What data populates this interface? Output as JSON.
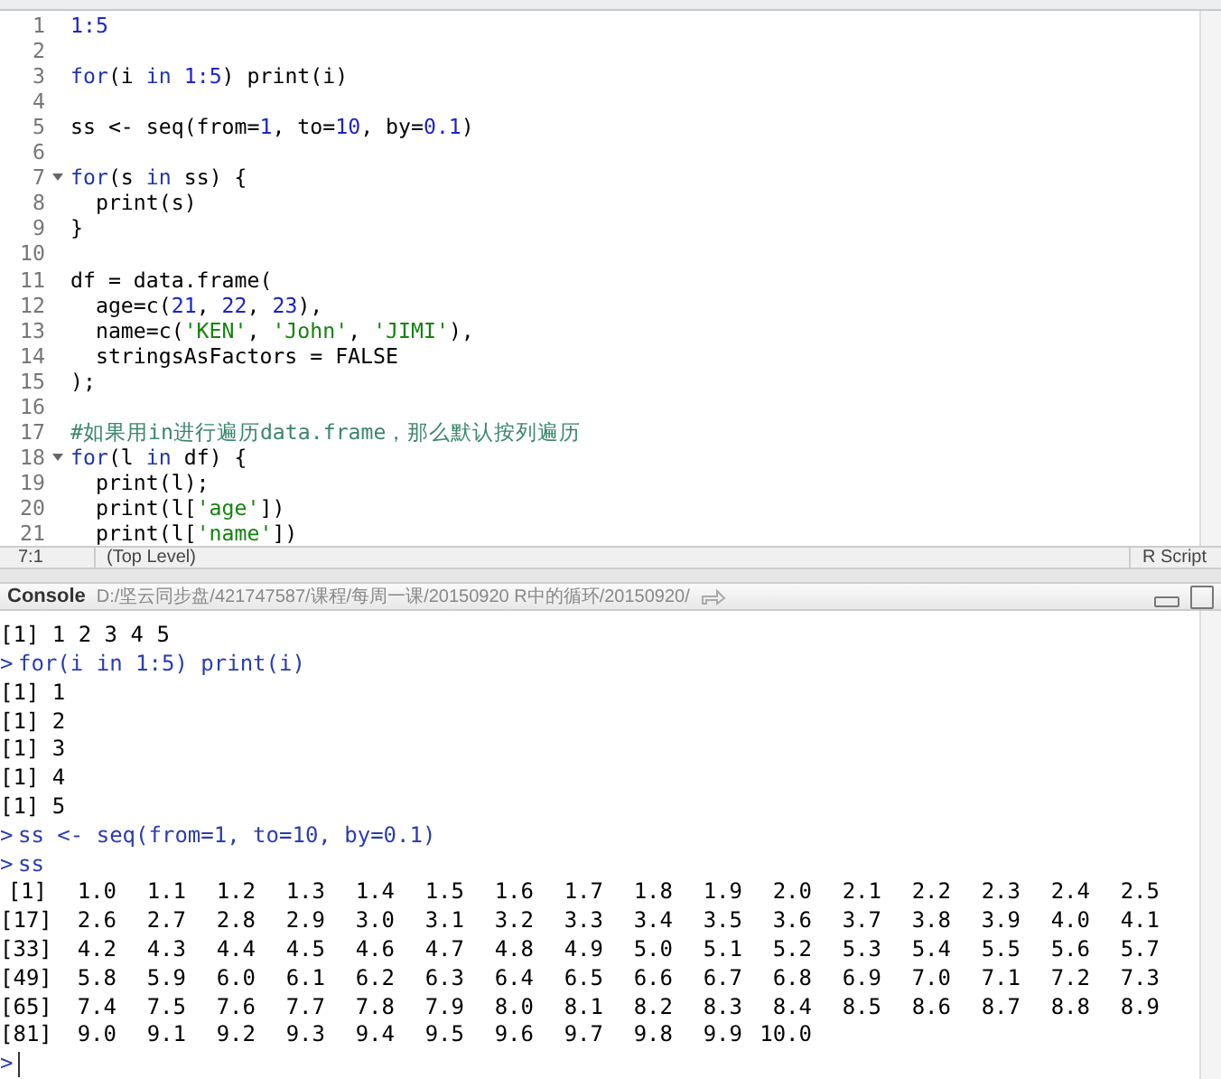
{
  "editor": {
    "lines": [
      {
        "number": "1",
        "fold": false,
        "tokens": [
          {
            "text": "1:5",
            "kind": "number"
          }
        ]
      },
      {
        "number": "2",
        "fold": false
      },
      {
        "number": "3",
        "fold": false,
        "tokens": [
          {
            "text": "for",
            "kind": "keyword"
          },
          {
            "text": "(i ",
            "kind": "plain"
          },
          {
            "text": "in",
            "kind": "keyword"
          },
          {
            "text": " 1:5",
            "kind": "number"
          },
          {
            "text": ") print(i)",
            "kind": "plain"
          }
        ]
      },
      {
        "number": "4",
        "fold": false
      },
      {
        "number": "5",
        "fold": false,
        "tokens": [
          {
            "text": "ss <- seq(from=",
            "kind": "plain"
          },
          {
            "text": "1",
            "kind": "number"
          },
          {
            "text": ", to=",
            "kind": "plain"
          },
          {
            "text": "10",
            "kind": "number"
          },
          {
            "text": ", by=",
            "kind": "plain"
          },
          {
            "text": "0.1",
            "kind": "number"
          },
          {
            "text": ")",
            "kind": "plain"
          }
        ]
      },
      {
        "number": "6",
        "fold": false
      },
      {
        "number": "7",
        "fold": true,
        "tokens": [
          {
            "text": "for",
            "kind": "keyword"
          },
          {
            "text": "(s ",
            "kind": "plain"
          },
          {
            "text": "in",
            "kind": "keyword"
          },
          {
            "text": " ss) {",
            "kind": "plain"
          }
        ]
      },
      {
        "number": "8",
        "fold": false,
        "tokens": [
          {
            "text": "  print(s)",
            "kind": "plain"
          }
        ]
      },
      {
        "number": "9",
        "fold": false,
        "tokens": [
          {
            "text": "}",
            "kind": "plain"
          }
        ]
      },
      {
        "number": "10",
        "fold": false
      },
      {
        "number": "11",
        "fold": false,
        "tokens": [
          {
            "text": "df = data.frame(",
            "kind": "plain"
          }
        ]
      },
      {
        "number": "12",
        "fold": false,
        "tokens": [
          {
            "text": "  age=c(",
            "kind": "plain"
          },
          {
            "text": "21",
            "kind": "number"
          },
          {
            "text": ", ",
            "kind": "plain"
          },
          {
            "text": "22",
            "kind": "number"
          },
          {
            "text": ", ",
            "kind": "plain"
          },
          {
            "text": "23",
            "kind": "number"
          },
          {
            "text": "),",
            "kind": "plain"
          }
        ]
      },
      {
        "number": "13",
        "fold": false,
        "tokens": [
          {
            "text": "  name=c(",
            "kind": "plain"
          },
          {
            "text": "'KEN'",
            "kind": "string"
          },
          {
            "text": ", ",
            "kind": "plain"
          },
          {
            "text": "'John'",
            "kind": "string"
          },
          {
            "text": ", ",
            "kind": "plain"
          },
          {
            "text": "'JIMI'",
            "kind": "string"
          },
          {
            "text": "),",
            "kind": "plain"
          }
        ]
      },
      {
        "number": "14",
        "fold": false,
        "tokens": [
          {
            "text": "  stringsAsFactors = FALSE",
            "kind": "plain"
          }
        ]
      },
      {
        "number": "15",
        "fold": false,
        "tokens": [
          {
            "text": ");",
            "kind": "plain"
          }
        ]
      },
      {
        "number": "16",
        "fold": false
      },
      {
        "number": "17",
        "fold": false,
        "tokens": [
          {
            "text": "#如果用in进行遍历data.frame，那么默认按列遍历",
            "kind": "comment"
          }
        ]
      },
      {
        "number": "18",
        "fold": true,
        "tokens": [
          {
            "text": "for",
            "kind": "keyword"
          },
          {
            "text": "(l ",
            "kind": "plain"
          },
          {
            "text": "in",
            "kind": "keyword"
          },
          {
            "text": " df) {",
            "kind": "plain"
          }
        ]
      },
      {
        "number": "19",
        "fold": false,
        "tokens": [
          {
            "text": "  print(l);",
            "kind": "plain"
          }
        ]
      },
      {
        "number": "20",
        "fold": false,
        "tokens": [
          {
            "text": "  print(l[",
            "kind": "plain"
          },
          {
            "text": "'age'",
            "kind": "string"
          },
          {
            "text": "])",
            "kind": "plain"
          }
        ]
      },
      {
        "number": "21",
        "fold": false,
        "tokens": [
          {
            "text": "  print(l[",
            "kind": "plain"
          },
          {
            "text": "'name'",
            "kind": "string"
          },
          {
            "text": "])",
            "kind": "plain"
          }
        ]
      }
    ]
  },
  "status_bar": {
    "position": "7:1",
    "scope": "(Top Level)",
    "file_type": "R Script"
  },
  "console": {
    "title": "Console",
    "path": "D:/坚云同步盘/421747587/课程/每周一课/20150920 R中的循环/20150920/",
    "lines": [
      {
        "kind": "output",
        "text": "[1] 1 2 3 4 5"
      },
      {
        "kind": "command",
        "prompt": ">",
        "text": "for(i in 1:5) print(i)"
      },
      {
        "kind": "output",
        "text": "[1] 1"
      },
      {
        "kind": "output",
        "text": "[1] 2"
      },
      {
        "kind": "output",
        "text": "[1] 3"
      },
      {
        "kind": "output",
        "text": "[1] 4"
      },
      {
        "kind": "output",
        "text": "[1] 5"
      },
      {
        "kind": "command",
        "prompt": ">",
        "text": "ss <- seq(from=1, to=10, by=0.1)"
      },
      {
        "kind": "command",
        "prompt": ">",
        "text": "ss"
      },
      {
        "kind": "vector",
        "index": "[1]",
        "values": [
          "1.0",
          "1.1",
          "1.2",
          "1.3",
          "1.4",
          "1.5",
          "1.6",
          "1.7",
          "1.8",
          "1.9",
          "2.0",
          "2.1",
          "2.2",
          "2.3",
          "2.4",
          "2.5"
        ]
      },
      {
        "kind": "vector",
        "index": "[17]",
        "values": [
          "2.6",
          "2.7",
          "2.8",
          "2.9",
          "3.0",
          "3.1",
          "3.2",
          "3.3",
          "3.4",
          "3.5",
          "3.6",
          "3.7",
          "3.8",
          "3.9",
          "4.0",
          "4.1"
        ]
      },
      {
        "kind": "vector",
        "index": "[33]",
        "values": [
          "4.2",
          "4.3",
          "4.4",
          "4.5",
          "4.6",
          "4.7",
          "4.8",
          "4.9",
          "5.0",
          "5.1",
          "5.2",
          "5.3",
          "5.4",
          "5.5",
          "5.6",
          "5.7"
        ]
      },
      {
        "kind": "vector",
        "index": "[49]",
        "values": [
          "5.8",
          "5.9",
          "6.0",
          "6.1",
          "6.2",
          "6.3",
          "6.4",
          "6.5",
          "6.6",
          "6.7",
          "6.8",
          "6.9",
          "7.0",
          "7.1",
          "7.2",
          "7.3"
        ]
      },
      {
        "kind": "vector",
        "index": "[65]",
        "values": [
          "7.4",
          "7.5",
          "7.6",
          "7.7",
          "7.8",
          "7.9",
          "8.0",
          "8.1",
          "8.2",
          "8.3",
          "8.4",
          "8.5",
          "8.6",
          "8.7",
          "8.8",
          "8.9"
        ]
      },
      {
        "kind": "vector",
        "index": "[81]",
        "values": [
          "9.0",
          "9.1",
          "9.2",
          "9.3",
          "9.4",
          "9.5",
          "9.6",
          "9.7",
          "9.8",
          "9.9",
          "10.0"
        ]
      },
      {
        "kind": "prompt",
        "prompt": ">"
      }
    ]
  }
}
